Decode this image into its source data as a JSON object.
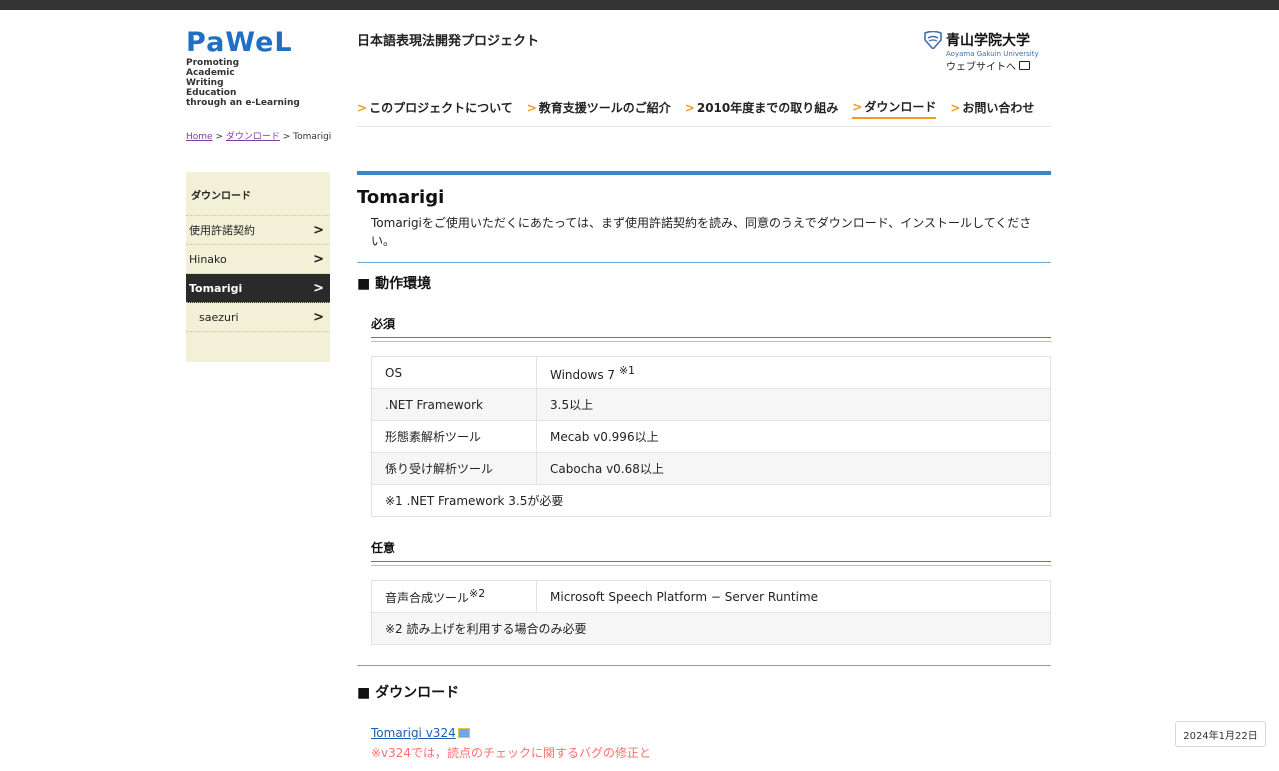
{
  "header": {
    "logo_mark": "PaWeL",
    "logo_lines": [
      "Promoting",
      "Academic",
      "Writing",
      "Education",
      "through an e-Learning"
    ],
    "project_title": "日本語表現法開発プロジェクト",
    "university_name": "青山学院大学",
    "university_en": "Aoyama Gakuin University",
    "university_link": "ウェブサイトへ",
    "nav": [
      {
        "label": "このプロジェクトについて",
        "active": false
      },
      {
        "label": "教育支援ツールのご紹介",
        "active": false
      },
      {
        "label": "2010年度までの取り組み",
        "active": false
      },
      {
        "label": "ダウンロード",
        "active": true
      },
      {
        "label": "お問い合わせ",
        "active": false
      }
    ]
  },
  "breadcrumb": {
    "home": "Home",
    "sep": " > ",
    "download": "ダウンロード",
    "current": "Tomarigi"
  },
  "sidebar": {
    "title": "ダウンロード",
    "items": [
      {
        "label": "使用許諾契約",
        "active": false
      },
      {
        "label": "Hinako",
        "active": false
      },
      {
        "label": "Tomarigi",
        "active": true
      },
      {
        "label": "saezuri",
        "active": false
      }
    ],
    "chevron": ">"
  },
  "main": {
    "title": "Tomarigi",
    "intro": "Tomarigiをご使用いただくにあたっては、まず使用許諾契約を読み、同意のうえでダウンロード、インストールしてください。",
    "env_heading": "■ 動作環境",
    "required_heading": "必須",
    "required_rows": [
      {
        "key": "OS",
        "value": "Windows 7 ",
        "sup": "※1"
      },
      {
        "key": ".NET Framework",
        "value": "3.5以上"
      },
      {
        "key": "形態素解析ツール",
        "value": "Mecab v0.996以上"
      },
      {
        "key": "係り受け解析ツール",
        "value": "Cabocha v0.68以上"
      }
    ],
    "required_note": "※1 .NET Framework 3.5が必要",
    "optional_heading": "任意",
    "optional_row": {
      "key": "音声合成ツール",
      "sup": "※2",
      "value": "Microsoft Speech Platform − Server Runtime"
    },
    "optional_note": "※2 読み上げを利用する場合のみ必要",
    "download_heading": "■ ダウンロード",
    "download_link": "Tomarigi v324",
    "download_note": "※v324では，読点のチェックに関するバグの修正と"
  },
  "date_badge": "2024年1月22日",
  "colors": {
    "accent_blue": "#3b86c9",
    "nav_orange": "#f39a1a",
    "sidebar_bg": "#f2f1d7",
    "note_red": "#ff6f6f"
  }
}
